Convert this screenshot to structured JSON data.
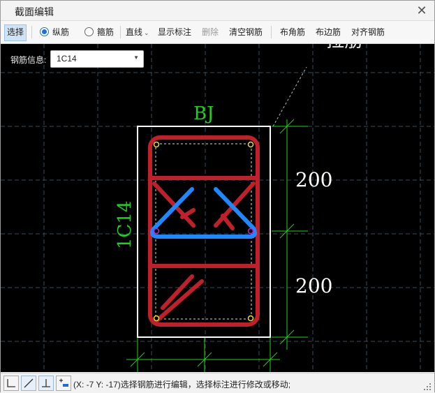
{
  "window": {
    "title": "截面编辑"
  },
  "toolbar": {
    "select": "选择",
    "longitudinal": "纵筋",
    "stirrup": "箍筋",
    "line_mode": "直线",
    "show_annotation": "显示标注",
    "delete": "删除",
    "clear_rebar": "清空钢筋",
    "corner_rebar": "布角筋",
    "edge_rebar": "布边筋",
    "align_rebar": "对齐钢筋",
    "selected_radio": "纵筋"
  },
  "rebar_info": {
    "label": "钢筋信息:",
    "value": "1C14"
  },
  "drawing": {
    "section_name": "BJ",
    "side_label": "1C14",
    "dim_upper": "200",
    "dim_lower": "200",
    "partial_top_text": "拉筋"
  },
  "statusbar": {
    "text": "(X: -7 Y: -17)选择钢筋进行编辑，选择标注进行修改或移动;",
    "icons": [
      "orthogonal-icon",
      "diagonal-icon",
      "perpendicular-icon",
      "snap-icon"
    ]
  },
  "colors": {
    "canvas_bg": "#000000",
    "grid": "#3a4a5a",
    "stirrup": "#c0202a",
    "tie": "#1e88ff",
    "dimension": "#20d020",
    "outline": "#ffffff",
    "corner_bar": "#e8e020",
    "edge_bar": "#d020d0"
  }
}
